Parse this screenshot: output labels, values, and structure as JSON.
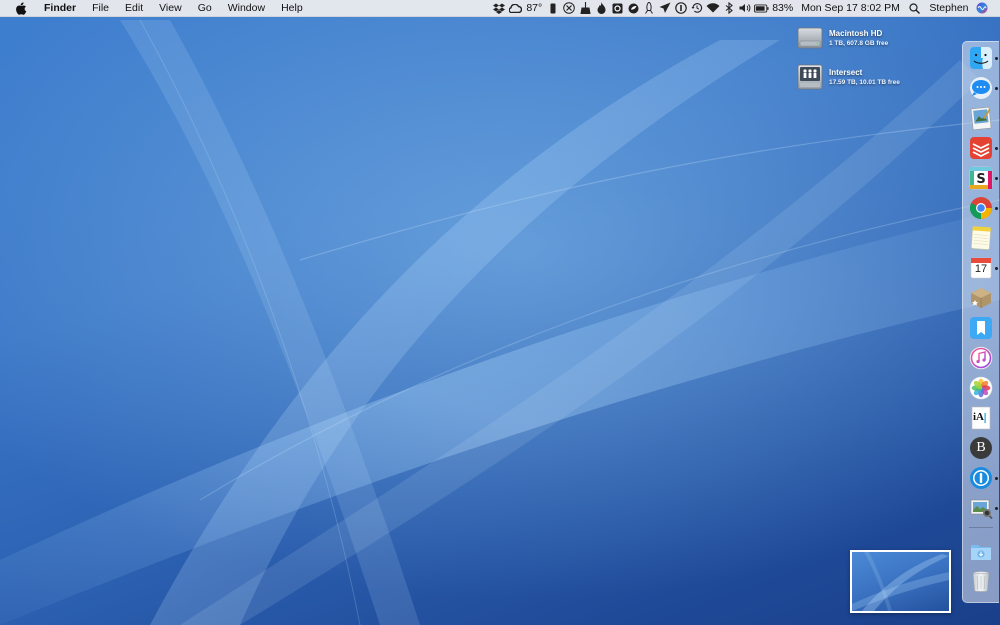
{
  "menubar": {
    "app_name": "Finder",
    "menus": [
      "File",
      "Edit",
      "View",
      "Go",
      "Window",
      "Help"
    ],
    "temperature": "87°",
    "battery_percent": "83%",
    "datetime": "Mon Sep 17  8:02 PM",
    "user": "Stephen",
    "status_icons": [
      "dropbox-icon",
      "creative-cloud-icon",
      "temperature-icon",
      "phone-icon",
      "accessibility-icon",
      "broom-icon",
      "flame-icon",
      "square-o-icon",
      "shield-icon",
      "rocket-icon",
      "plane-icon",
      "onepassword-icon",
      "time-machine-icon",
      "wifi-icon",
      "bluetooth-icon",
      "volume-icon",
      "battery-icon",
      "spotlight-icon",
      "siri-icon"
    ]
  },
  "desktop": {
    "disks": [
      {
        "name": "Macintosh HD",
        "info": "1 TB, 607.8 GB free",
        "icon": "internal-drive-icon"
      },
      {
        "name": "Intersect",
        "info": "17.59 TB, 10.01 TB free",
        "icon": "network-drive-icon"
      }
    ]
  },
  "dock": {
    "items": [
      {
        "app": "Finder",
        "icon": "finder-icon",
        "running": true
      },
      {
        "app": "Messages",
        "icon": "messages-icon",
        "running": true
      },
      {
        "app": "Preview",
        "icon": "preview-icon",
        "running": false
      },
      {
        "app": "Todoist",
        "icon": "todoist-icon",
        "running": true
      },
      {
        "app": "Slack",
        "icon": "slack-icon",
        "running": true
      },
      {
        "app": "Chrome",
        "icon": "chrome-icon",
        "running": true
      },
      {
        "app": "Notes",
        "icon": "notes-icon",
        "running": false
      },
      {
        "app": "Calendar",
        "icon": "calendar-icon",
        "running": true,
        "label": "17"
      },
      {
        "app": "Deliveries",
        "icon": "package-icon",
        "running": false
      },
      {
        "app": "Bookmarks",
        "icon": "bookmark-icon",
        "running": false
      },
      {
        "app": "iTunes",
        "icon": "itunes-icon",
        "running": false
      },
      {
        "app": "Photos",
        "icon": "photos-icon",
        "running": false
      },
      {
        "app": "iA Writer",
        "icon": "ia-writer-icon",
        "running": false,
        "label": "iA"
      },
      {
        "app": "Bear",
        "icon": "bear-icon",
        "running": false,
        "label": "B"
      },
      {
        "app": "1Password",
        "icon": "onepassword-icon",
        "running": true
      },
      {
        "app": "Image Capture",
        "icon": "image-capture-icon",
        "running": true
      }
    ],
    "stack_items": [
      {
        "name": "Downloads",
        "icon": "downloads-folder-icon"
      },
      {
        "name": "Trash",
        "icon": "trash-icon"
      }
    ]
  },
  "colors": {
    "menubar_bg": "#ececee",
    "desktop_base": "#2a66b8",
    "dock_bg": "#e1e8f2"
  }
}
